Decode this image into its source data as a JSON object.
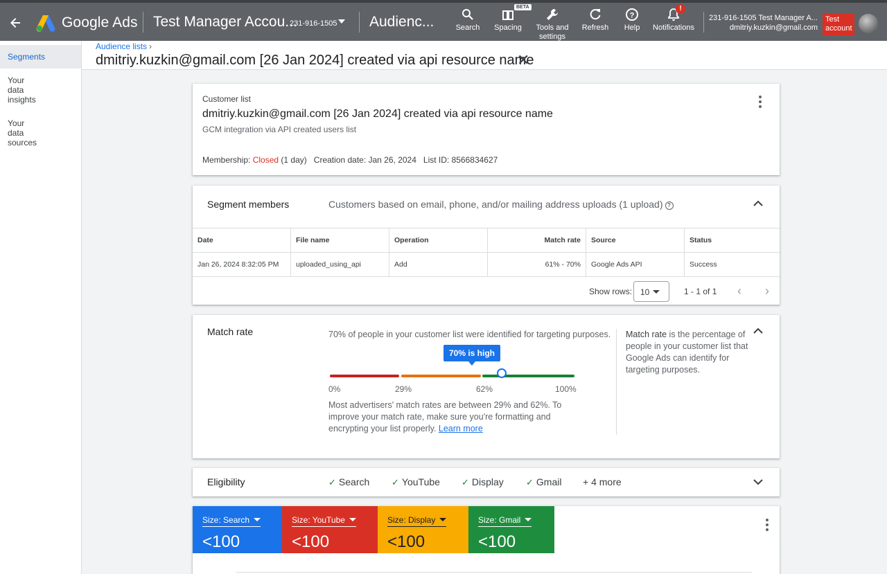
{
  "topbar": {
    "brand": "Google Ads",
    "account_name": "Test Manager Accou...",
    "account_id": "231-916-1505",
    "page_name": "Audienc...",
    "tools": [
      {
        "label": "Search"
      },
      {
        "label": "Spacing"
      },
      {
        "label": "Tools and settings"
      },
      {
        "label": "Refresh"
      },
      {
        "label": "Help"
      },
      {
        "label": "Notifications"
      }
    ],
    "beta_badge": "BETA",
    "notification_badge": "!",
    "user_line1": "231-916-1505 Test Manager A...",
    "user_line2": "dmitriy.kuzkin@gmail.com",
    "test_badge": "Test account"
  },
  "leftnav": {
    "items": [
      {
        "label": "Segments",
        "active": true
      },
      {
        "label": "Your data insights"
      },
      {
        "label": "Your data sources"
      }
    ]
  },
  "header": {
    "breadcrumb": "Audience lists",
    "title": "dmitriy.kuzkin@gmail.com [26 Jan 2024] created via api resource name"
  },
  "summary": {
    "type": "Customer list",
    "name": "dmitriy.kuzkin@gmail.com [26 Jan 2024] created via api resource name",
    "description": "GCM integration via API created users list",
    "membership_label": "Membership:",
    "membership_status": "Closed",
    "membership_duration": "(1 day)",
    "creation_date": "Creation date: Jan 26, 2024",
    "list_id": "List ID: 8566834627"
  },
  "members": {
    "title": "Segment members",
    "subtitle": "Customers based on email, phone, and/or mailing address uploads (1 upload)",
    "columns": [
      "Date",
      "File name",
      "Operation",
      "Match rate",
      "Source",
      "Status"
    ],
    "rows": [
      [
        "Jan 26, 2024 8:32:05 PM",
        "uploaded_using_api",
        "Add",
        "61% - 70%",
        "Google Ads API",
        "Success"
      ]
    ],
    "show_rows_label": "Show rows:",
    "show_rows_value": "10",
    "range": "1 - 1 of 1"
  },
  "match_rate": {
    "title": "Match rate",
    "lead": "70% of people in your customer list were identified for targeting purposes.",
    "callout": "70% is high",
    "value_percent": 70,
    "ticks": [
      "0%",
      "29%",
      "62%",
      "100%"
    ],
    "colors": {
      "low": "#c5221f",
      "mid": "#e8710a",
      "high": "#188038",
      "marker": "#1a73e8"
    },
    "note": "Most advertisers' match rates are between 29% and 62%. To improve your match rate, make sure you're formatting and encrypting your list properly.",
    "learn_more": "Learn more",
    "side_bold": "Match rate",
    "side_rest": " is the percentage of people in your customer list that Google Ads can identify for targeting purposes."
  },
  "eligibility": {
    "title": "Eligibility",
    "items": [
      "Search",
      "YouTube",
      "Display",
      "Gmail"
    ],
    "more": "+ 4 more"
  },
  "sizes": {
    "tiles": [
      {
        "label": "Size: Search",
        "value": "<100",
        "color": "#1a73e8"
      },
      {
        "label": "Size: YouTube",
        "value": "<100",
        "color": "#d93025"
      },
      {
        "label": "Size: Display",
        "value": "<100",
        "color": "#f9ab00"
      },
      {
        "label": "Size: Gmail",
        "value": "<100",
        "color": "#1e8e3e"
      }
    ]
  },
  "icons": [
    "back-arrow-icon",
    "google-ads-logo",
    "search-icon",
    "spacing-icon",
    "wrench-icon",
    "refresh-icon",
    "help-icon",
    "bell-icon",
    "close-icon",
    "kebab-icon",
    "chevron-up-icon",
    "chevron-down-icon",
    "check-icon"
  ]
}
